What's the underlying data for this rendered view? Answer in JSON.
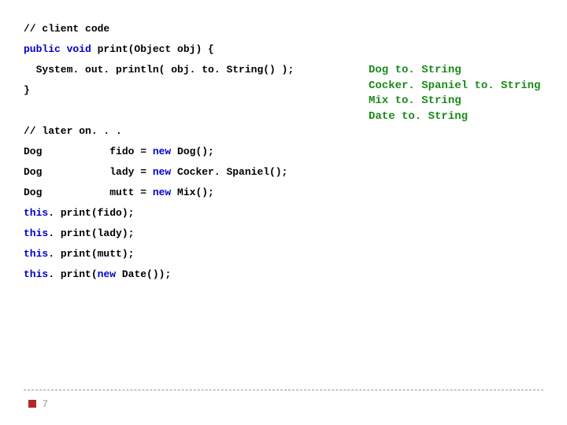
{
  "code": {
    "lines": [
      {
        "segments": [
          {
            "t": "// client code",
            "cls": ""
          }
        ]
      },
      {
        "segments": [
          {
            "t": "public void",
            "cls": "kw"
          },
          {
            "t": " print(Object obj) {",
            "cls": ""
          }
        ]
      },
      {
        "segments": [
          {
            "t": "  System. out. println( obj. to. String() );",
            "cls": ""
          }
        ]
      },
      {
        "segments": [
          {
            "t": "}",
            "cls": ""
          }
        ]
      },
      {
        "segments": [
          {
            "t": "",
            "cls": ""
          }
        ]
      },
      {
        "segments": [
          {
            "t": "// later on. . .",
            "cls": ""
          }
        ]
      },
      {
        "segments": [
          {
            "t": "Dog           fido = ",
            "cls": ""
          },
          {
            "t": "new",
            "cls": "kw"
          },
          {
            "t": " Dog();",
            "cls": ""
          }
        ]
      },
      {
        "segments": [
          {
            "t": "Dog           lady = ",
            "cls": ""
          },
          {
            "t": "new",
            "cls": "kw"
          },
          {
            "t": " Cocker. Spaniel();",
            "cls": ""
          }
        ]
      },
      {
        "segments": [
          {
            "t": "Dog           mutt = ",
            "cls": ""
          },
          {
            "t": "new",
            "cls": "kw"
          },
          {
            "t": " Mix();",
            "cls": ""
          }
        ]
      },
      {
        "segments": [
          {
            "t": "this",
            "cls": "kw"
          },
          {
            "t": ". print(fido);",
            "cls": ""
          }
        ]
      },
      {
        "segments": [
          {
            "t": "this",
            "cls": "kw"
          },
          {
            "t": ". print(lady);",
            "cls": ""
          }
        ]
      },
      {
        "segments": [
          {
            "t": "this",
            "cls": "kw"
          },
          {
            "t": ". print(mutt);",
            "cls": ""
          }
        ]
      },
      {
        "segments": [
          {
            "t": "this",
            "cls": "kw"
          },
          {
            "t": ". print(",
            "cls": ""
          },
          {
            "t": "new",
            "cls": "kw"
          },
          {
            "t": " Date());",
            "cls": ""
          }
        ]
      }
    ]
  },
  "output": {
    "lines": [
      "Dog to. String",
      "Cocker. Spaniel to. String",
      "Mix to. String",
      "Date to. String"
    ]
  },
  "page": {
    "number": "7"
  }
}
